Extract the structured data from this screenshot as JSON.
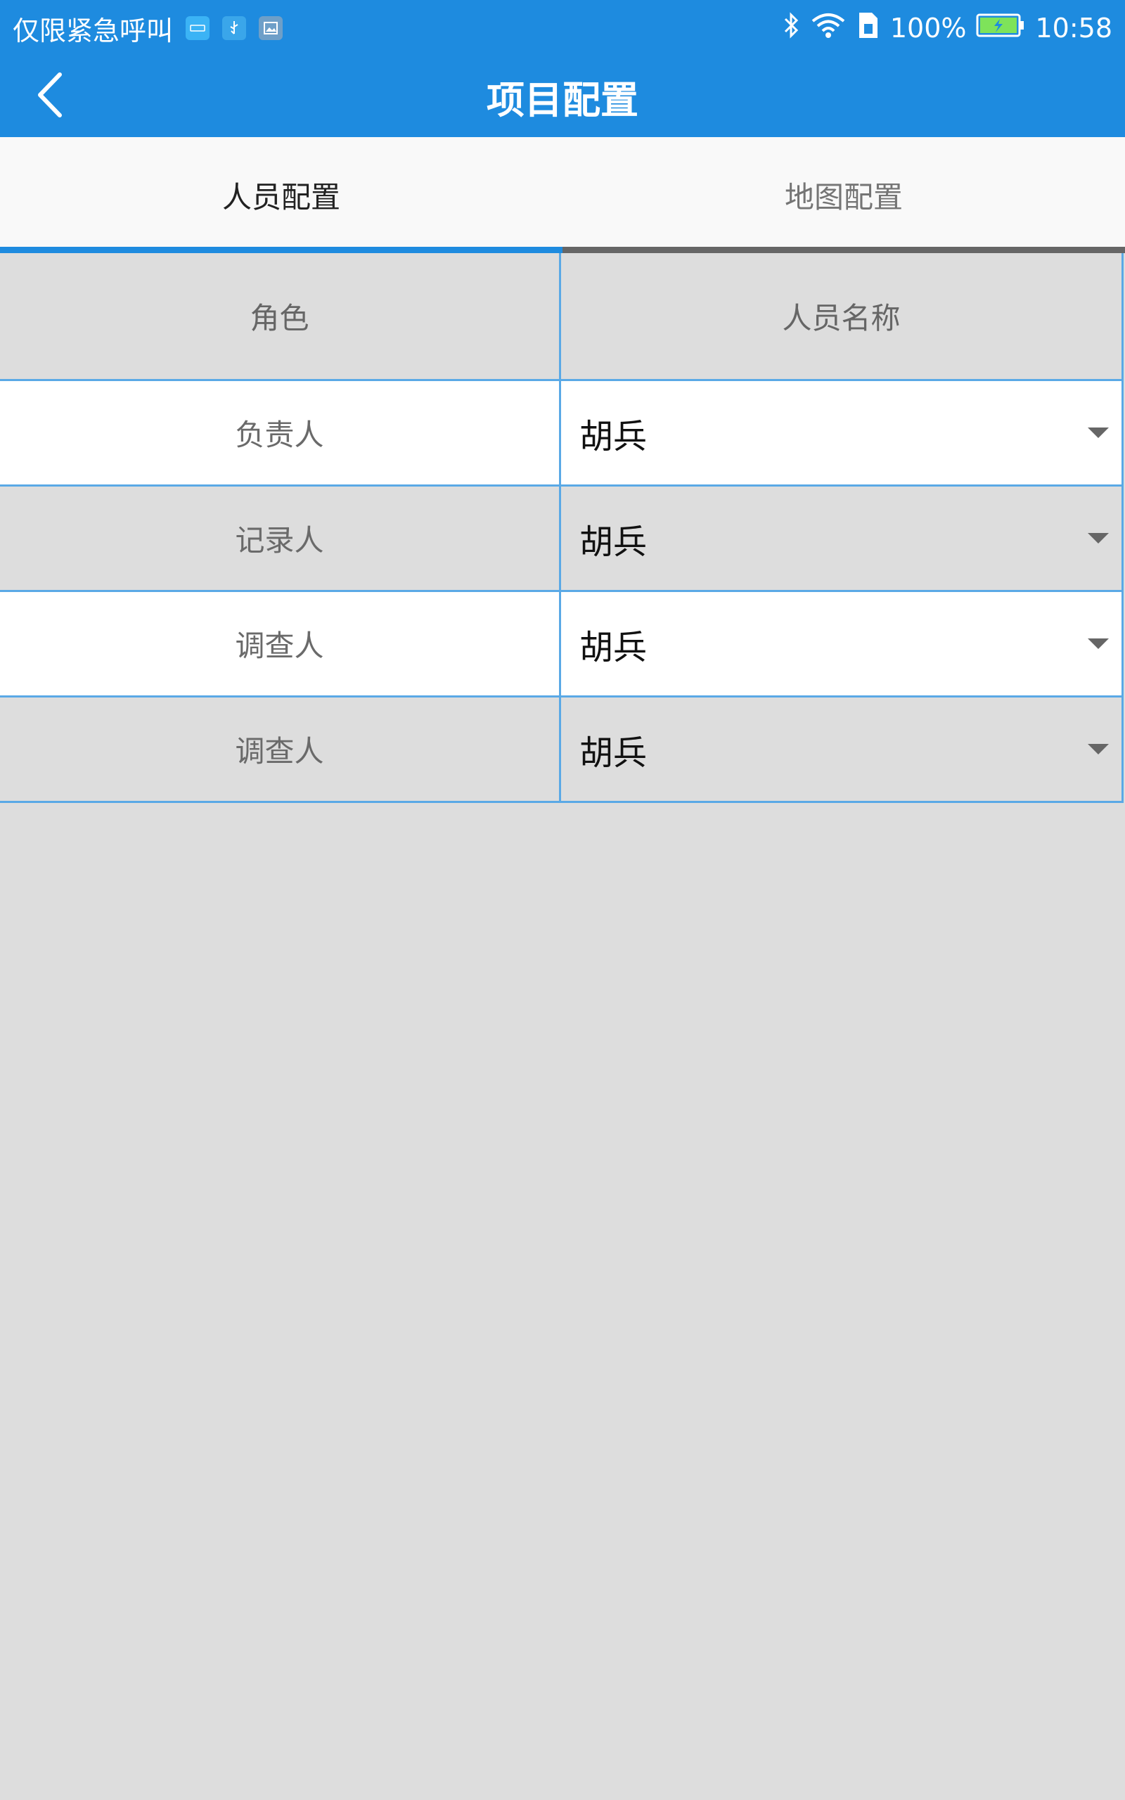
{
  "status_bar": {
    "carrier_text": "仅限紧急呼叫",
    "notification_icons": [
      "app-notification-icon",
      "usb-icon",
      "image-icon"
    ],
    "battery_percent": "100%",
    "time": "10:58"
  },
  "app_bar": {
    "title": "项目配置",
    "back_icon": "chevron-left-icon"
  },
  "tabs": [
    {
      "label": "人员配置",
      "active": true
    },
    {
      "label": "地图配置",
      "active": false
    }
  ],
  "table": {
    "headers": {
      "role": "角色",
      "person": "人员名称"
    },
    "rows": [
      {
        "role": "负责人",
        "person": "胡兵"
      },
      {
        "role": "记录人",
        "person": "胡兵"
      },
      {
        "role": "调查人",
        "person": "胡兵"
      },
      {
        "role": "调查人",
        "person": "胡兵"
      }
    ]
  },
  "colors": {
    "primary": "#1e8bdf",
    "background": "#dddddd",
    "row_border": "#5aa9e6"
  }
}
